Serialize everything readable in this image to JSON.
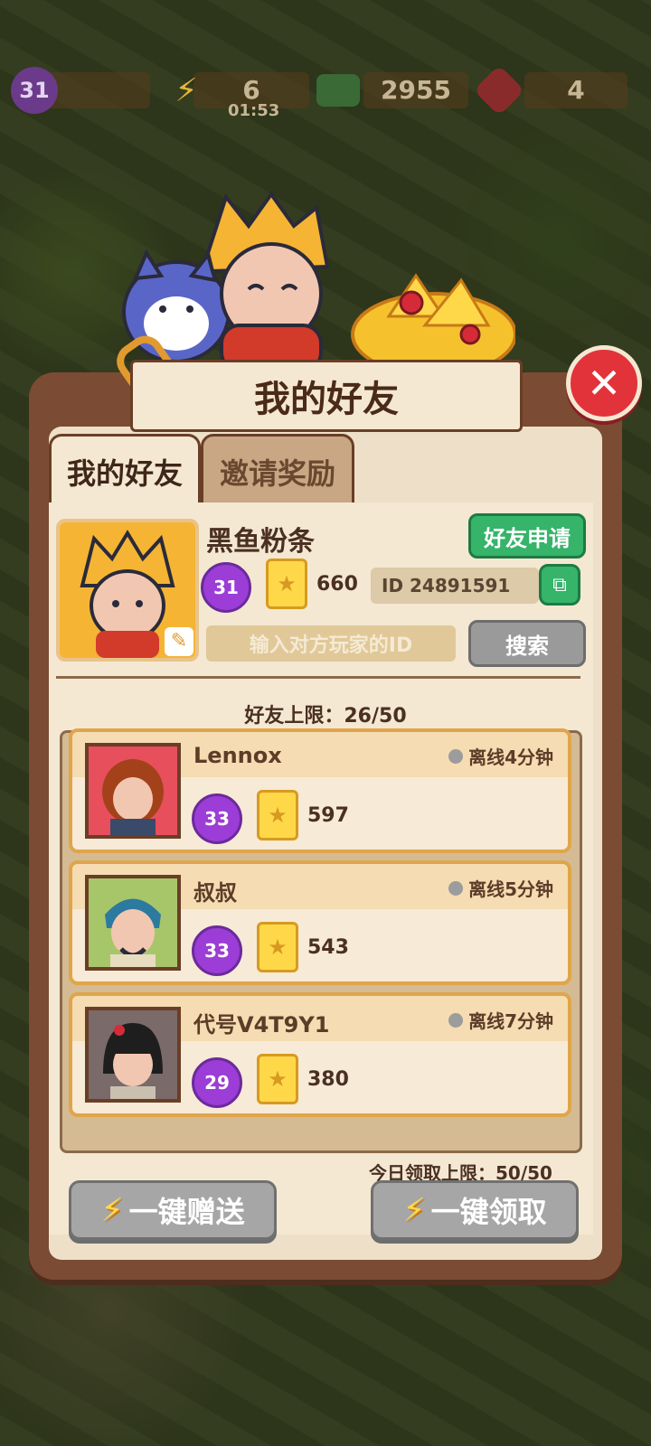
{
  "topbar": {
    "level": "31",
    "energy": "6",
    "energy_timer": "01:53",
    "cash": "2955",
    "gems": "4"
  },
  "dialog": {
    "title": "我的好友",
    "tabs": [
      {
        "label": "我的好友",
        "active": true
      },
      {
        "label": "邀请奖励",
        "active": false
      }
    ]
  },
  "profile": {
    "name": "黑鱼粉条",
    "level": "31",
    "score": "660",
    "id_text": "ID 24891591",
    "friend_request_label": "好友申请",
    "search_placeholder": "输入对方玩家的ID",
    "search_label": "搜索"
  },
  "friends_limit": "好友上限：26/50",
  "friends": [
    {
      "name": "Lennox",
      "status": "离线4分钟",
      "level": "33",
      "score": "597"
    },
    {
      "name": "叔叔",
      "status": "离线5分钟",
      "level": "33",
      "score": "543"
    },
    {
      "name": "代号V4T9Y1",
      "status": "离线7分钟",
      "level": "29",
      "score": "380"
    }
  ],
  "daily_limit": "今日领取上限：50/50",
  "actions": {
    "send_all": "一键赠送",
    "claim_all": "一键领取"
  },
  "colors": {
    "panel_brown": "#7b4b33",
    "panel_cream": "#f4e8d2",
    "accent_green": "#35b46a",
    "level_purple": "#9b3dd6",
    "close_red": "#e2333a"
  }
}
